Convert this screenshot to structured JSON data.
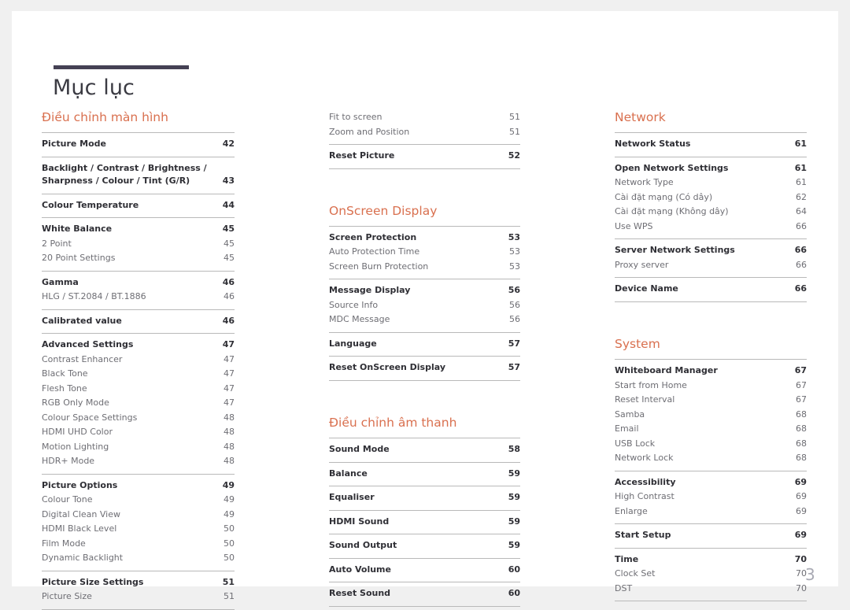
{
  "document": {
    "title": "Mục lục",
    "page_number": "3",
    "accent_color": "#d9704f",
    "title_bar_color": "#454154",
    "rule_color": "#b9b9b9"
  },
  "columns": [
    {
      "id": "column-1",
      "sections": [
        {
          "heading": "Điều chỉnh màn hình",
          "groups": [
            {
              "rule": true,
              "entries": [
                {
                  "label": "Picture Mode",
                  "page": "42",
                  "level": 1
                }
              ]
            },
            {
              "rule": true,
              "entries": [
                {
                  "label": "Backlight / Contrast / Brightness /\nSharpness / Colour / Tint (G/R)",
                  "page": "43",
                  "level": 1,
                  "multiline": true
                }
              ]
            },
            {
              "rule": true,
              "entries": [
                {
                  "label": "Colour Temperature",
                  "page": "44",
                  "level": 1
                }
              ]
            },
            {
              "rule": true,
              "entries": [
                {
                  "label": "White Balance",
                  "page": "45",
                  "level": 1
                },
                {
                  "label": "2 Point",
                  "page": "45",
                  "level": 2
                },
                {
                  "label": "20 Point Settings",
                  "page": "45",
                  "level": 2
                }
              ]
            },
            {
              "rule": true,
              "entries": [
                {
                  "label": "Gamma",
                  "page": "46",
                  "level": 1
                },
                {
                  "label": "HLG / ST.2084 / BT.1886",
                  "page": "46",
                  "level": 2
                }
              ]
            },
            {
              "rule": true,
              "entries": [
                {
                  "label": "Calibrated value",
                  "page": "46",
                  "level": 1
                }
              ]
            },
            {
              "rule": true,
              "entries": [
                {
                  "label": "Advanced Settings",
                  "page": "47",
                  "level": 1
                },
                {
                  "label": "Contrast Enhancer",
                  "page": "47",
                  "level": 2
                },
                {
                  "label": "Black Tone",
                  "page": "47",
                  "level": 2
                },
                {
                  "label": "Flesh Tone",
                  "page": "47",
                  "level": 2
                },
                {
                  "label": "RGB Only Mode",
                  "page": "47",
                  "level": 2
                },
                {
                  "label": "Colour Space Settings",
                  "page": "48",
                  "level": 2
                },
                {
                  "label": "HDMI UHD Color",
                  "page": "48",
                  "level": 2
                },
                {
                  "label": "Motion Lighting",
                  "page": "48",
                  "level": 2
                },
                {
                  "label": "HDR+ Mode",
                  "page": "48",
                  "level": 2
                }
              ]
            },
            {
              "rule": true,
              "entries": [
                {
                  "label": "Picture Options",
                  "page": "49",
                  "level": 1
                },
                {
                  "label": "Colour Tone",
                  "page": "49",
                  "level": 2
                },
                {
                  "label": "Digital Clean View",
                  "page": "49",
                  "level": 2
                },
                {
                  "label": "HDMI Black Level",
                  "page": "50",
                  "level": 2
                },
                {
                  "label": "Film Mode",
                  "page": "50",
                  "level": 2
                },
                {
                  "label": "Dynamic Backlight",
                  "page": "50",
                  "level": 2
                }
              ]
            },
            {
              "rule": true,
              "entries": [
                {
                  "label": "Picture Size Settings",
                  "page": "51",
                  "level": 1
                },
                {
                  "label": "Picture Size",
                  "page": "51",
                  "level": 2
                }
              ]
            }
          ]
        }
      ]
    },
    {
      "id": "column-2",
      "sections": [
        {
          "heading": "",
          "groups": [
            {
              "rule": false,
              "entries": [
                {
                  "label": "Fit to screen",
                  "page": "51",
                  "level": 2
                },
                {
                  "label": "Zoom and Position",
                  "page": "51",
                  "level": 2
                }
              ]
            },
            {
              "rule": true,
              "entries": [
                {
                  "label": "Reset Picture",
                  "page": "52",
                  "level": 1
                }
              ]
            }
          ]
        },
        {
          "heading": "OnScreen Display",
          "groups": [
            {
              "rule": true,
              "entries": [
                {
                  "label": "Screen Protection",
                  "page": "53",
                  "level": 1
                },
                {
                  "label": "Auto Protection Time",
                  "page": "53",
                  "level": 2
                },
                {
                  "label": "Screen Burn Protection",
                  "page": "53",
                  "level": 2
                }
              ]
            },
            {
              "rule": true,
              "entries": [
                {
                  "label": "Message Display",
                  "page": "56",
                  "level": 1
                },
                {
                  "label": "Source Info",
                  "page": "56",
                  "level": 2
                },
                {
                  "label": "MDC Message",
                  "page": "56",
                  "level": 2
                }
              ]
            },
            {
              "rule": true,
              "entries": [
                {
                  "label": "Language",
                  "page": "57",
                  "level": 1
                }
              ]
            },
            {
              "rule": true,
              "entries": [
                {
                  "label": "Reset OnScreen Display",
                  "page": "57",
                  "level": 1
                }
              ]
            }
          ]
        },
        {
          "heading": "Điều chỉnh âm thanh",
          "groups": [
            {
              "rule": true,
              "entries": [
                {
                  "label": "Sound Mode",
                  "page": "58",
                  "level": 1
                }
              ]
            },
            {
              "rule": true,
              "entries": [
                {
                  "label": "Balance",
                  "page": "59",
                  "level": 1
                }
              ]
            },
            {
              "rule": true,
              "entries": [
                {
                  "label": "Equaliser",
                  "page": "59",
                  "level": 1
                }
              ]
            },
            {
              "rule": true,
              "entries": [
                {
                  "label": "HDMI Sound",
                  "page": "59",
                  "level": 1
                }
              ]
            },
            {
              "rule": true,
              "entries": [
                {
                  "label": "Sound Output",
                  "page": "59",
                  "level": 1
                }
              ]
            },
            {
              "rule": true,
              "entries": [
                {
                  "label": "Auto Volume",
                  "page": "60",
                  "level": 1
                }
              ]
            },
            {
              "rule": true,
              "entries": [
                {
                  "label": "Reset Sound",
                  "page": "60",
                  "level": 1
                }
              ]
            }
          ]
        }
      ]
    },
    {
      "id": "column-3",
      "sections": [
        {
          "heading": "Network",
          "groups": [
            {
              "rule": true,
              "entries": [
                {
                  "label": "Network Status",
                  "page": "61",
                  "level": 1
                }
              ]
            },
            {
              "rule": true,
              "entries": [
                {
                  "label": "Open Network Settings",
                  "page": "61",
                  "level": 1
                },
                {
                  "label": "Network Type",
                  "page": "61",
                  "level": 2
                },
                {
                  "label": "Cài đặt mạng (Có dây)",
                  "page": "62",
                  "level": 2
                },
                {
                  "label": "Cài đặt mạng (Không dây)",
                  "page": "64",
                  "level": 2
                },
                {
                  "label": "Use WPS",
                  "page": "66",
                  "level": 2
                }
              ]
            },
            {
              "rule": true,
              "entries": [
                {
                  "label": "Server Network Settings",
                  "page": "66",
                  "level": 1
                },
                {
                  "label": "Proxy server",
                  "page": "66",
                  "level": 2
                }
              ]
            },
            {
              "rule": true,
              "entries": [
                {
                  "label": "Device Name",
                  "page": "66",
                  "level": 1
                }
              ]
            }
          ]
        },
        {
          "heading": "System",
          "groups": [
            {
              "rule": true,
              "entries": [
                {
                  "label": "Whiteboard Manager",
                  "page": "67",
                  "level": 1
                },
                {
                  "label": "Start from Home",
                  "page": "67",
                  "level": 2
                },
                {
                  "label": "Reset Interval",
                  "page": "67",
                  "level": 2
                },
                {
                  "label": "Samba",
                  "page": "68",
                  "level": 2
                },
                {
                  "label": "Email",
                  "page": "68",
                  "level": 2
                },
                {
                  "label": "USB Lock",
                  "page": "68",
                  "level": 2
                },
                {
                  "label": "Network Lock",
                  "page": "68",
                  "level": 2
                }
              ]
            },
            {
              "rule": true,
              "entries": [
                {
                  "label": "Accessibility",
                  "page": "69",
                  "level": 1
                },
                {
                  "label": "High Contrast",
                  "page": "69",
                  "level": 2
                },
                {
                  "label": "Enlarge",
                  "page": "69",
                  "level": 2
                }
              ]
            },
            {
              "rule": true,
              "entries": [
                {
                  "label": "Start Setup",
                  "page": "69",
                  "level": 1
                }
              ]
            },
            {
              "rule": true,
              "entries": [
                {
                  "label": "Time",
                  "page": "70",
                  "level": 1
                },
                {
                  "label": "Clock Set",
                  "page": "70",
                  "level": 2
                },
                {
                  "label": "DST",
                  "page": "70",
                  "level": 2
                }
              ]
            }
          ]
        }
      ]
    }
  ]
}
